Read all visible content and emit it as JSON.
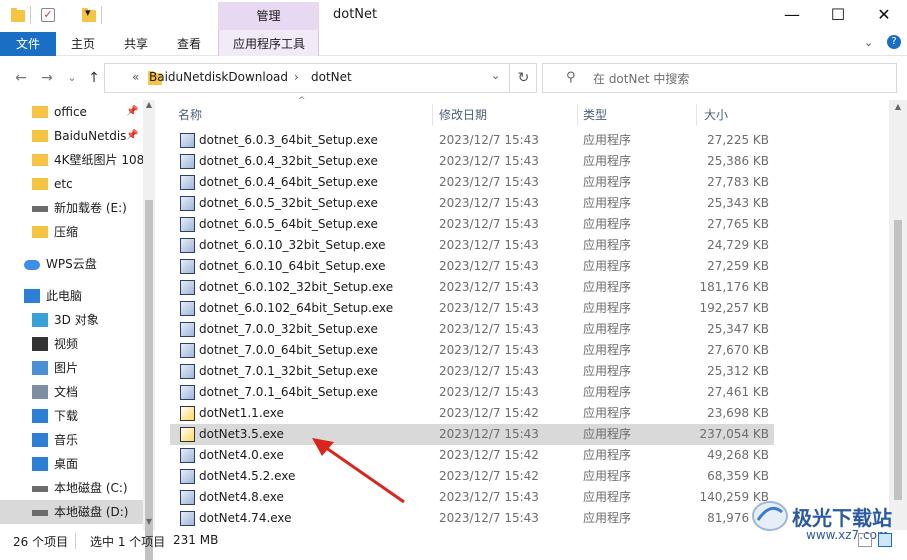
{
  "window": {
    "title": "dotNet",
    "context_header": "管理",
    "minimize": "—",
    "maximize": "☐",
    "close": "✕"
  },
  "ribbon": {
    "tabs": [
      "文件",
      "主页",
      "共享",
      "查看",
      "应用程序工具"
    ],
    "help": "?"
  },
  "address": {
    "back": "←",
    "forward": "→",
    "recent": "⌄",
    "up": "↑",
    "crumbs": [
      "«",
      "BaiduNetdiskDownload",
      "›",
      "dotNet"
    ],
    "refresh": "↻",
    "dropdown": "⌄"
  },
  "search": {
    "placeholder": "在 dotNet 中搜索"
  },
  "nav": {
    "items": [
      {
        "label": "office",
        "icon": "folder-icon",
        "pin": true
      },
      {
        "label": "BaiduNetdis",
        "icon": "folder-icon",
        "pin": true
      },
      {
        "label": "4K壁纸图片 108",
        "icon": "folder-icon"
      },
      {
        "label": "etc",
        "icon": "folder-icon"
      },
      {
        "label": "新加载卷 (E:)",
        "icon": "drive-icon"
      },
      {
        "label": "压缩",
        "icon": "folder-icon"
      },
      {
        "label": "WPS云盘",
        "icon": "cloud-icon"
      },
      {
        "label": "此电脑",
        "icon": "computer-icon"
      },
      {
        "label": "3D 对象",
        "icon": "cube-icon"
      },
      {
        "label": "视频",
        "icon": "video-icon"
      },
      {
        "label": "图片",
        "icon": "picture-icon"
      },
      {
        "label": "文档",
        "icon": "document-icon"
      },
      {
        "label": "下载",
        "icon": "download-icon"
      },
      {
        "label": "音乐",
        "icon": "music-icon"
      },
      {
        "label": "桌面",
        "icon": "desktop-icon"
      },
      {
        "label": "本地磁盘 (C:)",
        "icon": "drive-icon"
      },
      {
        "label": "本地磁盘 (D:)",
        "icon": "drive-icon",
        "selected": true
      }
    ]
  },
  "columns": {
    "name": "名称",
    "date": "修改日期",
    "type": "类型",
    "size": "大小"
  },
  "files": [
    {
      "name": "dotnet_6.0.3_64bit_Setup.exe",
      "date": "2023/12/7 15:43",
      "type": "应用程序",
      "size": "27,225 KB"
    },
    {
      "name": "dotnet_6.0.4_32bit_Setup.exe",
      "date": "2023/12/7 15:43",
      "type": "应用程序",
      "size": "25,386 KB"
    },
    {
      "name": "dotnet_6.0.4_64bit_Setup.exe",
      "date": "2023/12/7 15:43",
      "type": "应用程序",
      "size": "27,783 KB"
    },
    {
      "name": "dotnet_6.0.5_32bit_Setup.exe",
      "date": "2023/12/7 15:43",
      "type": "应用程序",
      "size": "25,343 KB"
    },
    {
      "name": "dotnet_6.0.5_64bit_Setup.exe",
      "date": "2023/12/7 15:43",
      "type": "应用程序",
      "size": "27,765 KB"
    },
    {
      "name": "dotnet_6.0.10_32bit_Setup.exe",
      "date": "2023/12/7 15:43",
      "type": "应用程序",
      "size": "24,729 KB"
    },
    {
      "name": "dotnet_6.0.10_64bit_Setup.exe",
      "date": "2023/12/7 15:43",
      "type": "应用程序",
      "size": "27,259 KB"
    },
    {
      "name": "dotnet_6.0.102_32bit_Setup.exe",
      "date": "2023/12/7 15:43",
      "type": "应用程序",
      "size": "181,176 KB"
    },
    {
      "name": "dotnet_6.0.102_64bit_Setup.exe",
      "date": "2023/12/7 15:43",
      "type": "应用程序",
      "size": "192,257 KB"
    },
    {
      "name": "dotnet_7.0.0_32bit_Setup.exe",
      "date": "2023/12/7 15:43",
      "type": "应用程序",
      "size": "25,347 KB"
    },
    {
      "name": "dotnet_7.0.0_64bit_Setup.exe",
      "date": "2023/12/7 15:43",
      "type": "应用程序",
      "size": "27,670 KB"
    },
    {
      "name": "dotnet_7.0.1_32bit_Setup.exe",
      "date": "2023/12/7 15:43",
      "type": "应用程序",
      "size": "25,312 KB"
    },
    {
      "name": "dotnet_7.0.1_64bit_Setup.exe",
      "date": "2023/12/7 15:43",
      "type": "应用程序",
      "size": "27,461 KB"
    },
    {
      "name": "dotNet1.1.exe",
      "date": "2023/12/7 15:42",
      "type": "应用程序",
      "size": "23,698 KB"
    },
    {
      "name": "dotNet3.5.exe",
      "date": "2023/12/7 15:43",
      "type": "应用程序",
      "size": "237,054 KB",
      "selected": true
    },
    {
      "name": "dotNet4.0.exe",
      "date": "2023/12/7 15:42",
      "type": "应用程序",
      "size": "49,268 KB"
    },
    {
      "name": "dotNet4.5.2.exe",
      "date": "2023/12/7 15:42",
      "type": "应用程序",
      "size": "68,359 KB"
    },
    {
      "name": "dotNet4.8.exe",
      "date": "2023/12/7 15:43",
      "type": "应用程序",
      "size": "140,259 KB"
    },
    {
      "name": "dotNet4.74.exe",
      "date": "2023/12/7 15:43",
      "type": "应用程序",
      "size": "81,976 KB"
    }
  ],
  "status": {
    "count": "26 个项目",
    "selection": "选中 1 个项目",
    "size": "231 MB"
  },
  "watermark": {
    "text": "极光下载站",
    "url": "www.xz7.com"
  },
  "colors": {
    "accent": "#1a6fc4",
    "context_tab": "#e8d9f2",
    "selected_row": "#d9d9d9",
    "arrow": "#d9261c"
  }
}
